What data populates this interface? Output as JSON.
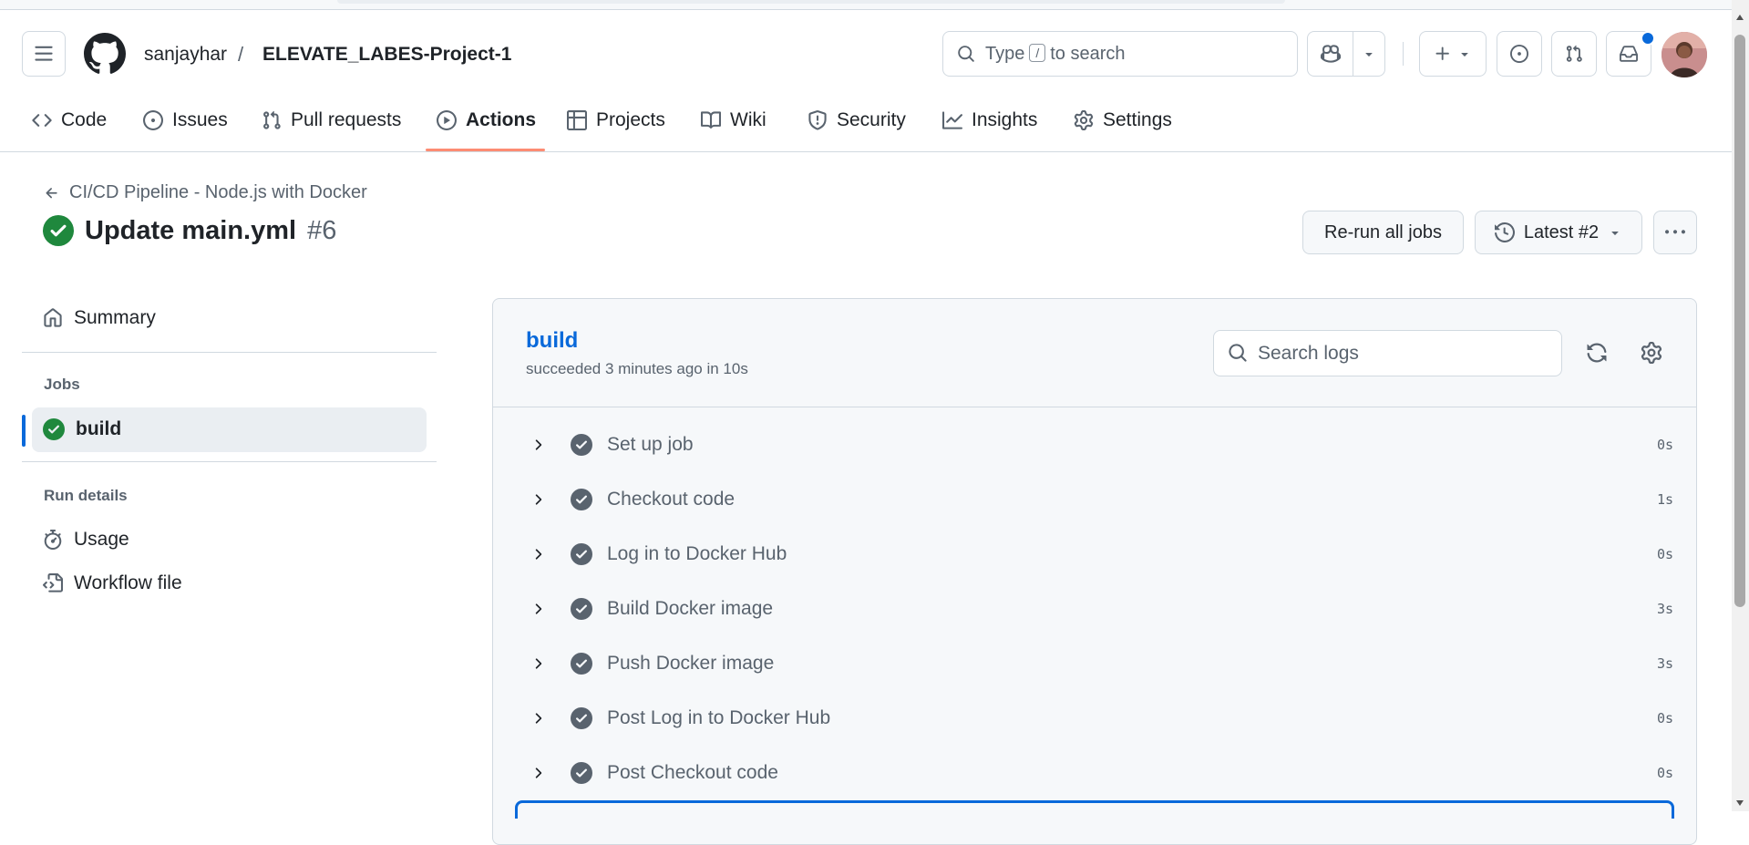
{
  "header": {
    "owner": "sanjayhar",
    "separator": "/",
    "repo": "ELEVATE_LABES-Project-1",
    "search": {
      "before": "Type",
      "key": "/",
      "after": "to search"
    }
  },
  "nav": {
    "tabs": [
      {
        "label": "Code",
        "icon": "code-icon"
      },
      {
        "label": "Issues",
        "icon": "issue-opened-icon"
      },
      {
        "label": "Pull requests",
        "icon": "git-pull-request-icon"
      },
      {
        "label": "Actions",
        "icon": "play-icon",
        "active": true
      },
      {
        "label": "Projects",
        "icon": "table-icon"
      },
      {
        "label": "Wiki",
        "icon": "book-icon"
      },
      {
        "label": "Security",
        "icon": "shield-icon"
      },
      {
        "label": "Insights",
        "icon": "graph-icon"
      },
      {
        "label": "Settings",
        "icon": "gear-icon"
      }
    ]
  },
  "run": {
    "workflow_link": "CI/CD Pipeline - Node.js with Docker",
    "title": "Update main.yml",
    "number": "#6",
    "rerun_label": "Re-run all jobs",
    "attempt_label": "Latest #2"
  },
  "sidebar": {
    "summary": "Summary",
    "jobs_heading": "Jobs",
    "jobs": [
      {
        "label": "build",
        "status": "success"
      }
    ],
    "run_details_heading": "Run details",
    "usage": "Usage",
    "workflow_file": "Workflow file"
  },
  "job": {
    "name": "build",
    "status_line": "succeeded 3 minutes ago in 10s",
    "search_placeholder": "Search logs",
    "steps": [
      {
        "name": "Set up job",
        "duration": "0s"
      },
      {
        "name": "Checkout code",
        "duration": "1s"
      },
      {
        "name": "Log in to Docker Hub",
        "duration": "0s"
      },
      {
        "name": "Build Docker image",
        "duration": "3s"
      },
      {
        "name": "Push Docker image",
        "duration": "3s"
      },
      {
        "name": "Post Log in to Docker Hub",
        "duration": "0s"
      },
      {
        "name": "Post Checkout code",
        "duration": "0s"
      }
    ]
  },
  "colors": {
    "success": "#1f883d",
    "accent": "#0969da",
    "active_tab_underline": "#fd8c73",
    "step_check": "#59636e"
  }
}
